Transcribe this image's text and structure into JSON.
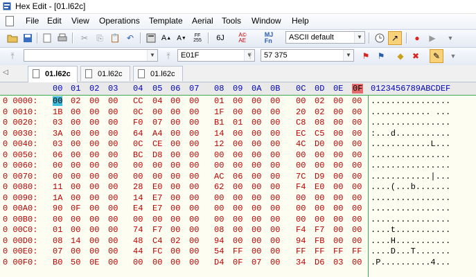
{
  "window": {
    "title": "Hex Edit - [01.l62c]"
  },
  "menu": [
    "File",
    "Edit",
    "View",
    "Operations",
    "Template",
    "Aerial",
    "Tools",
    "Window",
    "Help"
  ],
  "toolbar1": {
    "charset": "ASCII default"
  },
  "toolbar2": {
    "address": "E01F",
    "value": "57 375"
  },
  "tabs": [
    "01.l62c",
    "01.l62c",
    "01.l62c"
  ],
  "editor": {
    "header_cols": [
      "00",
      "01",
      "02",
      "03",
      "04",
      "05",
      "06",
      "07",
      "08",
      "09",
      "0A",
      "0B",
      "0C",
      "0D",
      "0E",
      "0F"
    ],
    "ascii_header": "0123456789ABCDEF",
    "rows": [
      {
        "addr": "0 0000:",
        "bytes": [
          "00",
          "02",
          "00",
          "00",
          "CC",
          "04",
          "00",
          "00",
          "01",
          "00",
          "00",
          "00",
          "00",
          "02",
          "00",
          "00"
        ],
        "ascii": "................"
      },
      {
        "addr": "0 0010:",
        "bytes": [
          "1B",
          "00",
          "00",
          "00",
          "0C",
          "00",
          "00",
          "00",
          "1F",
          "00",
          "00",
          "00",
          "20",
          "02",
          "00",
          "00"
        ],
        "ascii": "............ ..."
      },
      {
        "addr": "0 0020:",
        "bytes": [
          "03",
          "00",
          "00",
          "00",
          "F0",
          "07",
          "00",
          "00",
          "B1",
          "01",
          "00",
          "00",
          "C8",
          "08",
          "00",
          "00"
        ],
        "ascii": "................"
      },
      {
        "addr": "0 0030:",
        "bytes": [
          "3A",
          "00",
          "00",
          "00",
          "64",
          "A4",
          "00",
          "00",
          "14",
          "00",
          "00",
          "00",
          "EC",
          "C5",
          "00",
          "00"
        ],
        "ascii": ":...d..........."
      },
      {
        "addr": "0 0040:",
        "bytes": [
          "03",
          "00",
          "00",
          "00",
          "0C",
          "CE",
          "00",
          "00",
          "12",
          "00",
          "00",
          "00",
          "4C",
          "D0",
          "00",
          "00"
        ],
        "ascii": "............L..."
      },
      {
        "addr": "0 0050:",
        "bytes": [
          "06",
          "00",
          "00",
          "00",
          "BC",
          "D8",
          "00",
          "00",
          "00",
          "00",
          "00",
          "00",
          "00",
          "00",
          "00",
          "00"
        ],
        "ascii": "................"
      },
      {
        "addr": "0 0060:",
        "bytes": [
          "00",
          "00",
          "00",
          "00",
          "00",
          "00",
          "00",
          "00",
          "00",
          "00",
          "00",
          "00",
          "00",
          "00",
          "00",
          "00"
        ],
        "ascii": "................"
      },
      {
        "addr": "0 0070:",
        "bytes": [
          "00",
          "00",
          "00",
          "00",
          "00",
          "00",
          "00",
          "00",
          "AC",
          "06",
          "00",
          "00",
          "7C",
          "D9",
          "00",
          "00"
        ],
        "ascii": "............|..."
      },
      {
        "addr": "0 0080:",
        "bytes": [
          "11",
          "00",
          "00",
          "00",
          "28",
          "E0",
          "00",
          "00",
          "62",
          "00",
          "00",
          "00",
          "F4",
          "E0",
          "00",
          "00"
        ],
        "ascii": "....(...b......."
      },
      {
        "addr": "0 0090:",
        "bytes": [
          "1A",
          "00",
          "00",
          "00",
          "14",
          "E7",
          "00",
          "00",
          "00",
          "00",
          "00",
          "00",
          "00",
          "00",
          "00",
          "00"
        ],
        "ascii": "................"
      },
      {
        "addr": "0 00A0:",
        "bytes": [
          "90",
          "0F",
          "00",
          "00",
          "E4",
          "E7",
          "00",
          "00",
          "00",
          "00",
          "00",
          "00",
          "00",
          "00",
          "00",
          "00"
        ],
        "ascii": "................"
      },
      {
        "addr": "0 00B0:",
        "bytes": [
          "00",
          "00",
          "00",
          "00",
          "00",
          "00",
          "00",
          "00",
          "00",
          "00",
          "00",
          "00",
          "00",
          "00",
          "00",
          "00"
        ],
        "ascii": "................"
      },
      {
        "addr": "0 00C0:",
        "bytes": [
          "01",
          "00",
          "00",
          "00",
          "74",
          "F7",
          "00",
          "00",
          "08",
          "00",
          "00",
          "00",
          "F4",
          "F7",
          "00",
          "00"
        ],
        "ascii": "....t..........."
      },
      {
        "addr": "0 00D0:",
        "bytes": [
          "08",
          "14",
          "00",
          "00",
          "48",
          "C4",
          "02",
          "00",
          "94",
          "00",
          "00",
          "00",
          "94",
          "FB",
          "00",
          "00"
        ],
        "ascii": "....H..........."
      },
      {
        "addr": "0 00E0:",
        "bytes": [
          "07",
          "00",
          "00",
          "00",
          "44",
          "FC",
          "00",
          "00",
          "54",
          "FF",
          "00",
          "00",
          "FF",
          "FF",
          "FF",
          "FF"
        ],
        "ascii": "....D...T......."
      },
      {
        "addr": "0 00F0:",
        "bytes": [
          "B0",
          "50",
          "0E",
          "00",
          "00",
          "00",
          "00",
          "00",
          "D4",
          "0F",
          "07",
          "00",
          "34",
          "D6",
          "03",
          "00"
        ],
        "ascii": ".P..........4..."
      }
    ]
  },
  "colors": {
    "accent": "#3bbddb",
    "text": "#c00000",
    "header_text": "#0000c0",
    "selected_col": "#e56b6b"
  }
}
